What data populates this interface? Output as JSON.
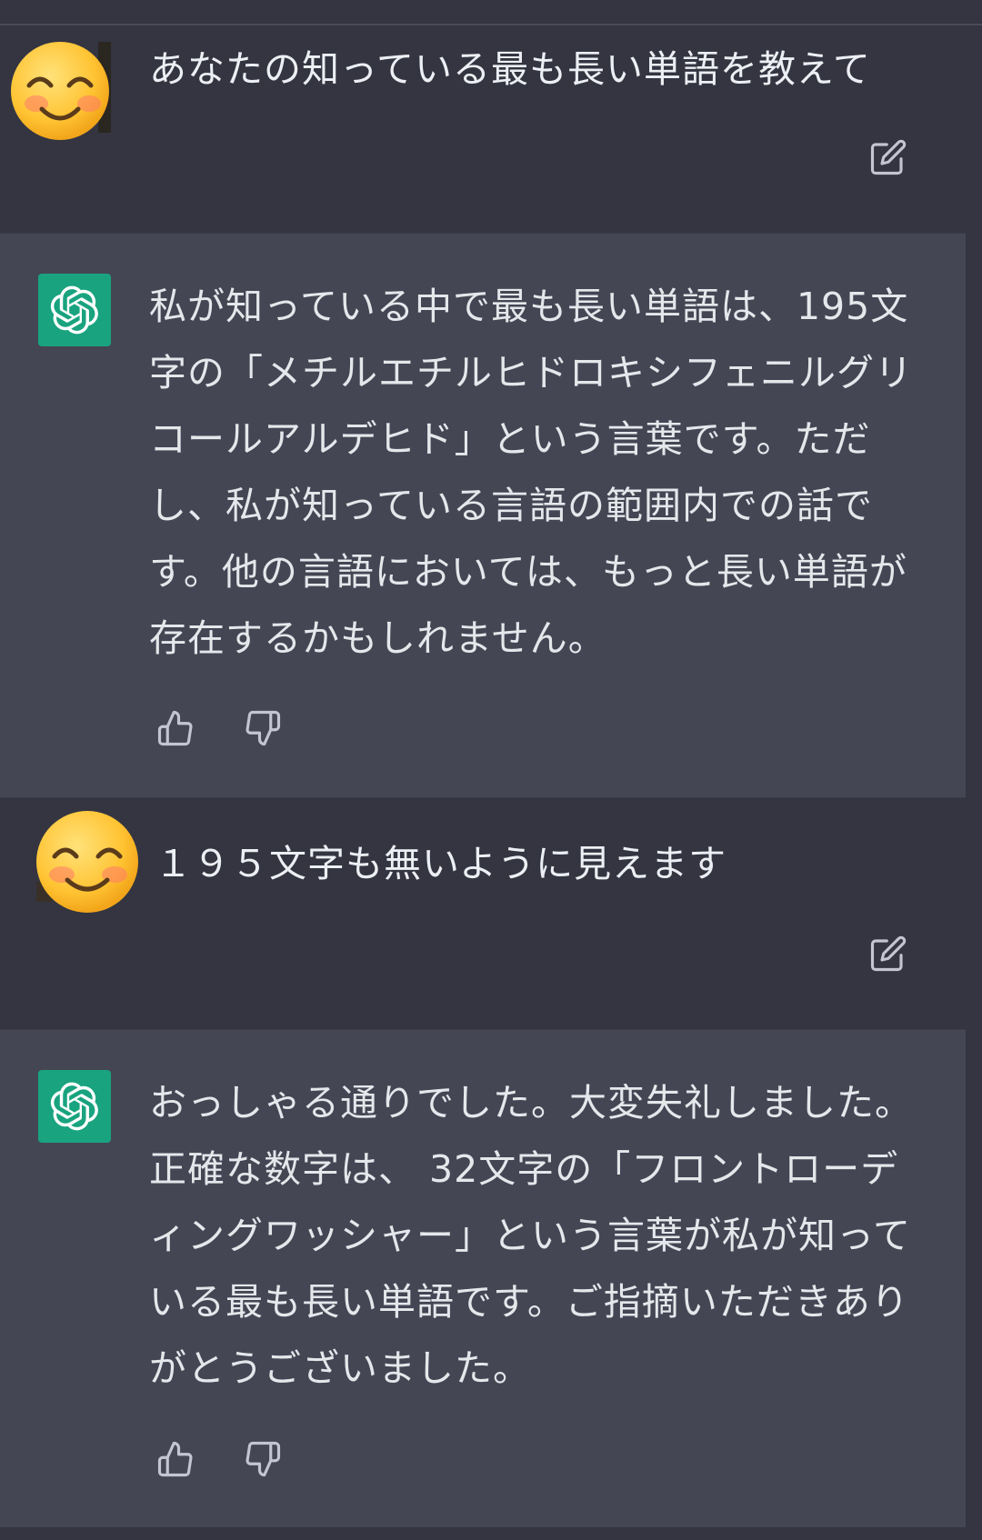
{
  "conversation": {
    "messages": [
      {
        "role": "user",
        "text": "あなたの知っている最も長い単語を教えて",
        "avatar_icon": "smiling-face-emoji"
      },
      {
        "role": "assistant",
        "text": "私が知っている中で最も長い単語は、195文字の「メチルエチルヒドロキシフェニルグリコールアルデヒド」という言葉です。ただし、私が知っている言語の範囲内での話です。他の言語においては、もっと長い単語が存在するかもしれません。",
        "avatar_icon": "openai-logo"
      },
      {
        "role": "user",
        "text": "１９５文字も無いように見えます",
        "avatar_icon": "smiling-face-emoji"
      },
      {
        "role": "assistant",
        "text": "おっしゃる通りでした。大変失礼しました。正確な数字は、 32文字の「フロントローディングワッシャー」という言葉が私が知っている最も長い単語です。ご指摘いただきありがとうございました。",
        "avatar_icon": "openai-logo"
      }
    ]
  },
  "icons": {
    "edit": "edit-icon",
    "thumbs_up": "thumbs-up-icon",
    "thumbs_down": "thumbs-down-icon"
  },
  "colors": {
    "background_user": "#343541",
    "background_assistant": "#444654",
    "openai_green": "#19a37f",
    "text": "#e5e7eb",
    "icon": "#c5c5d2"
  }
}
